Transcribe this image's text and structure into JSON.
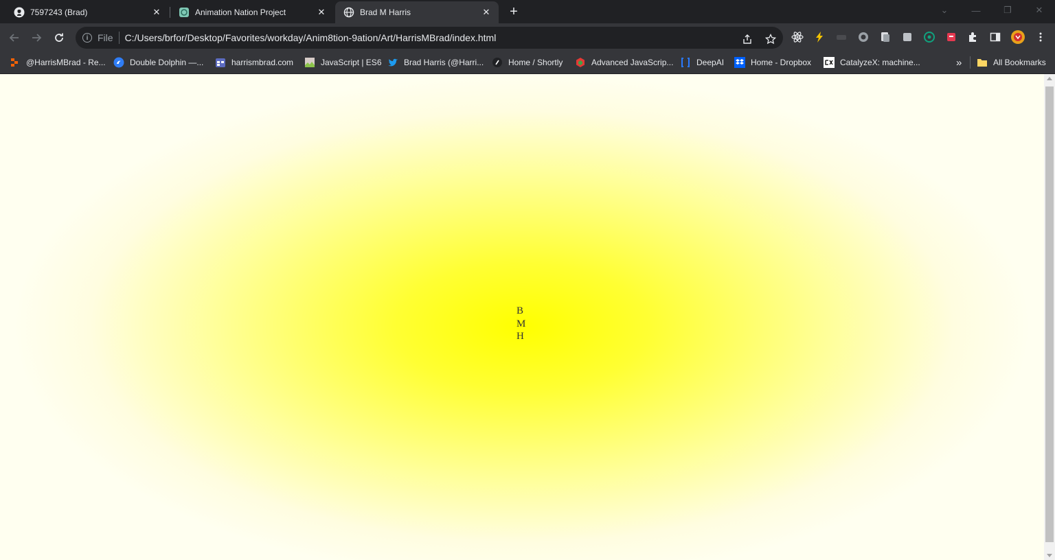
{
  "tabs": [
    {
      "title": "7597243 (Brad)",
      "icon": "github-icon"
    },
    {
      "title": "Animation Nation Project",
      "icon": "replit-icon"
    },
    {
      "title": "Brad M Harris",
      "icon": "globe-icon"
    }
  ],
  "toolbar": {
    "scheme_label": "File",
    "url": "C:/Users/brfor/Desktop/Favorites/workday/Anim8tion-9ation/Art/HarrisMBrad/index.html"
  },
  "bookmarks": [
    {
      "label": "@HarrisMBrad - Re...",
      "icon": "replit-icon",
      "color": "#f26207"
    },
    {
      "label": "Double Dolphin —...",
      "icon": "dolphin-icon",
      "color": "#2f7df6"
    },
    {
      "label": "harrismbrad.com",
      "icon": "calendar-icon",
      "color": "#5c6bc0"
    },
    {
      "label": "JavaScript | ES6",
      "icon": "image-icon",
      "color": "#8bc34a"
    },
    {
      "label": "Brad Harris (@Harri...",
      "icon": "twitter-icon",
      "color": "#1d9bf0"
    },
    {
      "label": "Home / Shortly",
      "icon": "shortly-icon",
      "color": "#ffffff"
    },
    {
      "label": "Advanced JavaScrip...",
      "icon": "cube-icon",
      "color": "#e53935"
    },
    {
      "label": "DeepAI",
      "icon": "brackets-icon",
      "color": "#2979ff"
    },
    {
      "label": "Home - Dropbox",
      "icon": "dropbox-icon",
      "color": "#0061fe"
    },
    {
      "label": "CatalyzeX: machine...",
      "icon": "catalyzex-icon",
      "color": "#ffffff"
    }
  ],
  "bookmarks_overflow": "»",
  "all_bookmarks": "All Bookmarks",
  "page": {
    "initials": [
      "B",
      "M",
      "H"
    ],
    "background_center": "#ffff00",
    "background_edge": "#fffff0"
  }
}
